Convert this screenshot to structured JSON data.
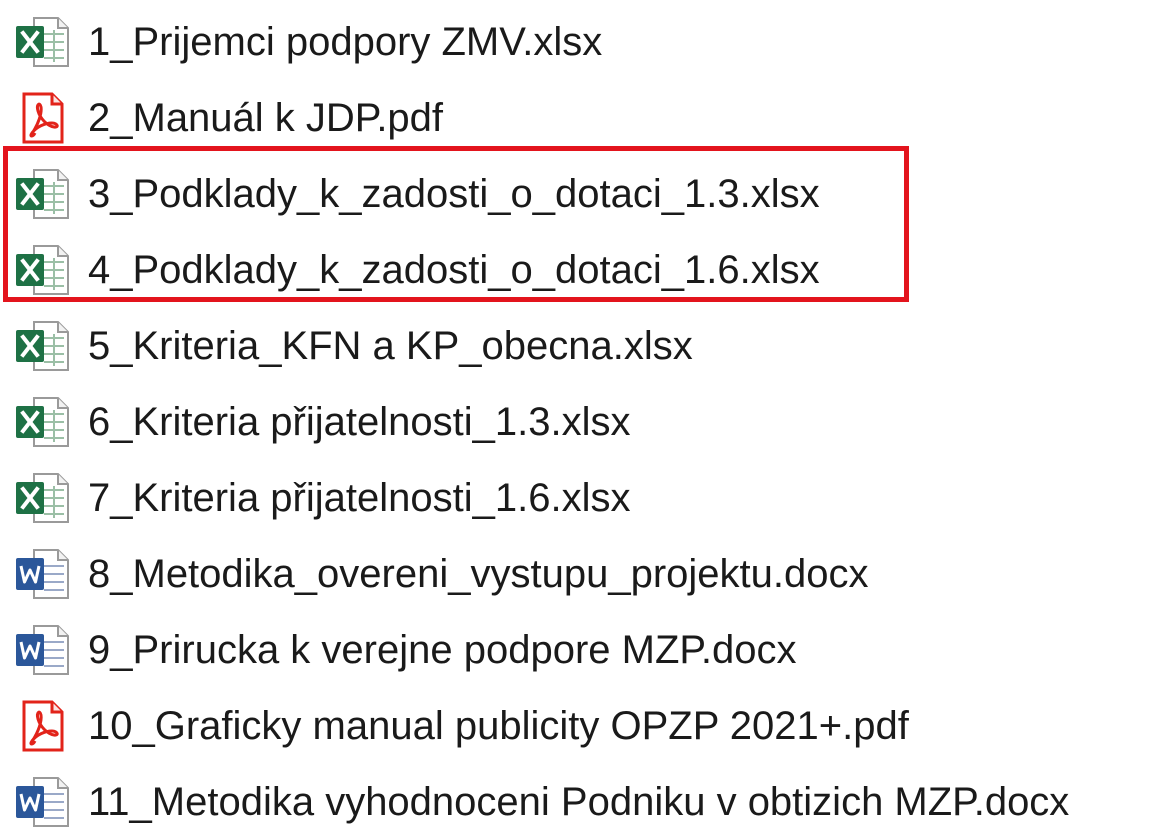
{
  "files": [
    {
      "name": "1_Prijemci podpory ZMV.xlsx",
      "icon": "excel-file-icon",
      "type": "xlsx"
    },
    {
      "name": "2_Manuál k JDP.pdf",
      "icon": "pdf-file-icon",
      "type": "pdf"
    },
    {
      "name": "3_Podklady_k_zadosti_o_dotaci_1.3.xlsx",
      "icon": "excel-file-icon",
      "type": "xlsx"
    },
    {
      "name": "4_Podklady_k_zadosti_o_dotaci_1.6.xlsx",
      "icon": "excel-file-icon",
      "type": "xlsx"
    },
    {
      "name": "5_Kriteria_KFN a KP_obecna.xlsx",
      "icon": "excel-file-icon",
      "type": "xlsx"
    },
    {
      "name": "6_Kriteria přijatelnosti_1.3.xlsx",
      "icon": "excel-file-icon",
      "type": "xlsx"
    },
    {
      "name": "7_Kriteria přijatelnosti_1.6.xlsx",
      "icon": "excel-file-icon",
      "type": "xlsx"
    },
    {
      "name": "8_Metodika_overeni_vystupu_projektu.docx",
      "icon": "word-file-icon",
      "type": "docx"
    },
    {
      "name": "9_Prirucka k verejne podpore MZP.docx",
      "icon": "word-file-icon",
      "type": "docx"
    },
    {
      "name": "10_Graficky manual publicity OPZP 2021+.pdf",
      "icon": "pdf-file-icon",
      "type": "pdf"
    },
    {
      "name": "11_Metodika vyhodnoceni Podniku v obtizich MZP.docx",
      "icon": "word-file-icon",
      "type": "docx"
    }
  ],
  "highlight": {
    "color": "#e3141d",
    "covers_files": [
      3,
      4
    ]
  },
  "colors": {
    "excel": "#1e7145",
    "pdf": "#e2231a",
    "word": "#2b579a"
  }
}
